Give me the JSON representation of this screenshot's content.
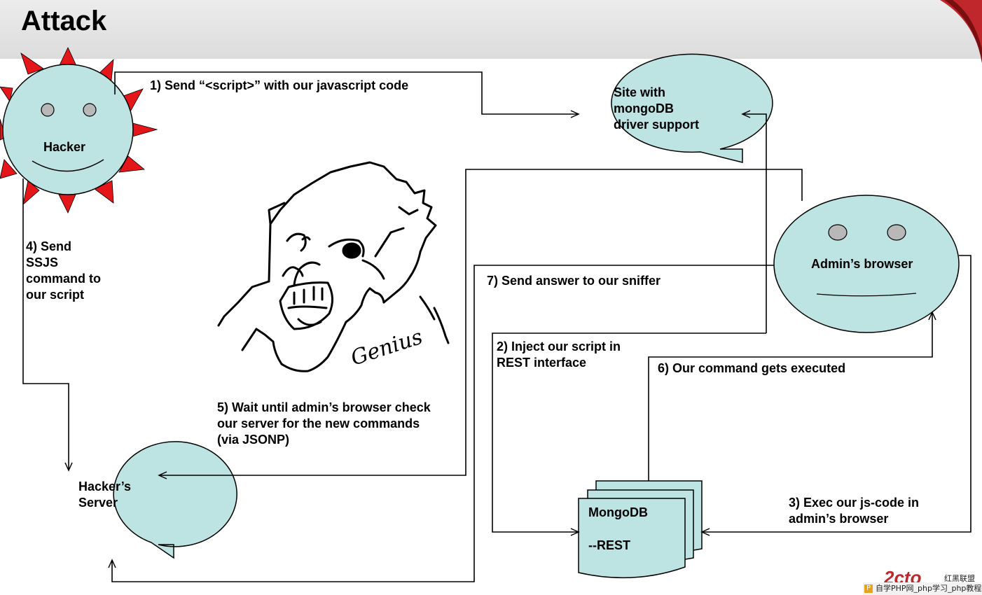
{
  "slide": {
    "title": "Attack"
  },
  "nodes": {
    "hacker": {
      "label": "Hacker"
    },
    "site": {
      "label": "Site with\nmongoDB\ndriver support"
    },
    "admin_browser": {
      "label": "Admin’s browser"
    },
    "hackers_server": {
      "label": "Hacker’s\nServer"
    },
    "mongodb": {
      "label": "MongoDB",
      "sublabel": "--REST"
    }
  },
  "edges": {
    "step1": {
      "label": "1) Send “<script>” with our javascript code"
    },
    "step2": {
      "label": "2) Inject our script in\nREST interface"
    },
    "step3": {
      "label": "3) Exec our js-code in\nadmin’s browser"
    },
    "step4": {
      "label": "4) Send\nSSJS\ncommand to\nour script"
    },
    "step5": {
      "label": "5) Wait until admin’s browser check\nour server for the new commands\n(via JSONP)"
    },
    "step6": {
      "label": "6) Our command gets executed"
    },
    "step7": {
      "label": "7) Send answer to our sniffer"
    }
  },
  "illustration": {
    "caption": "Genius"
  },
  "watermark": {
    "logo": "2cto",
    "brand": "红黑联盟",
    "strip": "自学PHP网_php学习_php教程"
  },
  "colors": {
    "node_fill": "#bde3e2",
    "sun_rays": "#e4161a",
    "title_bar": "#e2e2e2",
    "accent": "#c0272d"
  }
}
